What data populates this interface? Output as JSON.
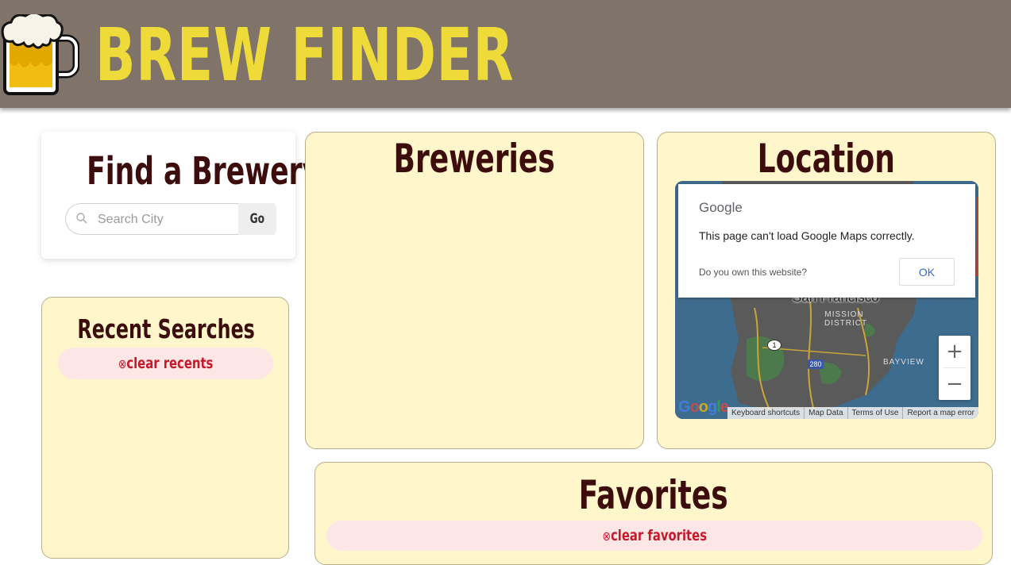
{
  "header": {
    "brand": "BREW FINDER",
    "logo_icon": "beer-mug-icon"
  },
  "finder": {
    "title": "Find a Brewery",
    "search_placeholder": "Search City",
    "search_value": "",
    "go_label": "Go"
  },
  "recent": {
    "title": "Recent Searches",
    "clear_icon": "⊗",
    "clear_label": "clear recents"
  },
  "breweries": {
    "title": "Breweries"
  },
  "location": {
    "title": "Location",
    "map": {
      "city_label": "San Francisco",
      "district_label": "MISSION DISTRICT",
      "bayview_label": "BAYVIEW",
      "route_1": "1",
      "route_280": "280",
      "google_logo": "Google",
      "zoom_in": "+",
      "zoom_out": "−",
      "footer": [
        "Keyboard shortcuts",
        "Map Data",
        "Terms of Use",
        "Report a map error"
      ]
    },
    "dialog": {
      "brand": "Google",
      "message": "This page can't load Google Maps correctly.",
      "own_question": "Do you own this website?",
      "ok_label": "OK"
    }
  },
  "favorites": {
    "title": "Favorites",
    "clear_icon": "⊗",
    "clear_label": "clear favorites"
  },
  "colors": {
    "header_bg": "#80746a",
    "brand_yellow": "#eedb3a",
    "title_maroon": "#3d0c0c",
    "panel_bg": "#fff7cb",
    "pill_bg": "#fde6e6",
    "pill_text": "#c41a2a"
  }
}
